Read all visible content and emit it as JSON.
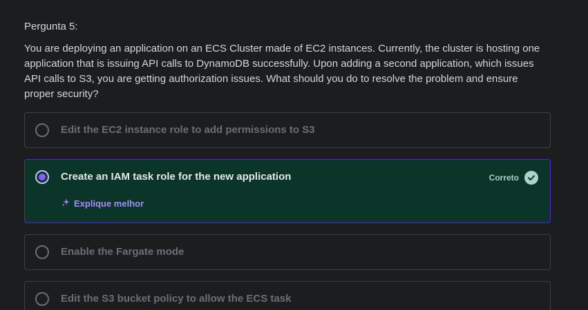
{
  "question": {
    "number_label": "Pergunta 5:",
    "text": "You are deploying an application on an ECS Cluster made of EC2 instances. Currently, the cluster is hosting one application that is issuing API calls to DynamoDB successfully. Upon adding a second application, which issues API calls to S3, you are getting authorization issues. What should you do to resolve the problem and ensure proper security?"
  },
  "options": [
    {
      "label": "Edit the EC2 instance role to add permissions to S3",
      "state": "default"
    },
    {
      "label": "Create an IAM task role for the new application",
      "state": "selected-correct"
    },
    {
      "label": "Enable the Fargate mode",
      "state": "default"
    },
    {
      "label": "Edit the S3 bucket policy to allow the ECS task",
      "state": "default"
    }
  ],
  "feedback": {
    "correct_label": "Correto",
    "explain_label": "Explique melhor",
    "correct_icon": "check-circle-icon",
    "explain_icon": "sparkle-icon"
  },
  "colors": {
    "background": "#1c1d1f",
    "correct_background": "#0b3529",
    "correct_border": "#5624d0",
    "correct_accent": "#acd2cc",
    "explain_link": "#a78bfa",
    "radio_selected": "#8b5cf6"
  }
}
